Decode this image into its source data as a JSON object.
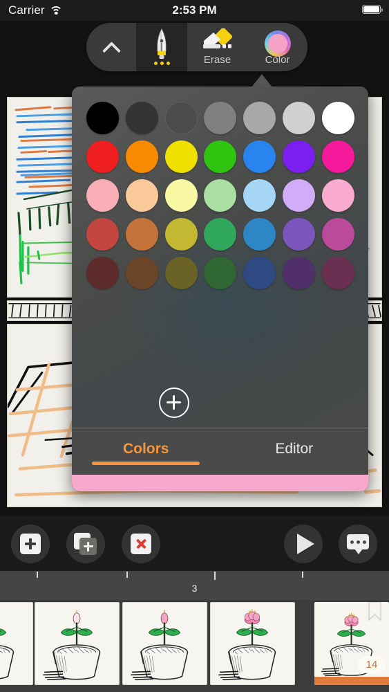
{
  "status_bar": {
    "carrier": "Carrier",
    "wifi_icon": "wifi-icon",
    "time": "2:53 PM",
    "battery_icon": "battery-full-icon"
  },
  "toolbar": {
    "collapse_icon": "chevron-up-icon",
    "pen": {
      "name": "pen-tool",
      "icon": "fountain-pen-nib-icon",
      "more_dots": "three-dots-indicator"
    },
    "erase": {
      "label": "Erase",
      "icon": "eraser-icon"
    },
    "color": {
      "label": "Color",
      "icon": "color-wheel-icon",
      "current_color": "#f4a3c6"
    }
  },
  "color_popover": {
    "add_color_label": "add-color",
    "tabs": [
      {
        "label": "Colors",
        "active": true
      },
      {
        "label": "Editor",
        "active": false
      }
    ],
    "accent_color": "#f5963f",
    "selected_color_bar": "#f7a8cd",
    "swatches": [
      "#000000",
      "#333333",
      "#4b4b4b",
      "#808080",
      "#a8a8a8",
      "#d0d0d0",
      "#ffffff",
      "#f01f1f",
      "#f78a00",
      "#f0e000",
      "#2ec40f",
      "#2a84f0",
      "#7a1ff0",
      "#f51a9b",
      "#f9aeb5",
      "#f9c999",
      "#f9f9a3",
      "#a9dfa0",
      "#a6d6f5",
      "#d2acf7",
      "#f9abd0",
      "#c4443f",
      "#c4743a",
      "#c4b833",
      "#2fa85c",
      "#2f86c4",
      "#7a56bc",
      "#bc4a9c",
      "#5e2b2b",
      "#6b4527",
      "#6b6325",
      "#2f6632",
      "#2f4a82",
      "#512f6b",
      "#6b2f52"
    ]
  },
  "bottom_toolbar": {
    "buttons": [
      {
        "name": "add-frame-button",
        "icon": "plus-square-icon"
      },
      {
        "name": "duplicate-frame-button",
        "icon": "duplicate-plus-icon"
      },
      {
        "name": "delete-frame-button",
        "icon": "x-square-icon"
      },
      {
        "name": "play-button",
        "icon": "play-icon"
      },
      {
        "name": "comment-button",
        "icon": "speech-bubble-dots-icon"
      }
    ]
  },
  "timeline": {
    "marker_label": "3",
    "ticks": [
      53,
      183,
      310,
      437
    ]
  },
  "filmstrip": {
    "frames": [
      {
        "index": 0,
        "partial": true,
        "current": false
      },
      {
        "index": 1,
        "partial": false,
        "current": false
      },
      {
        "index": 2,
        "partial": false,
        "current": false
      },
      {
        "index": 3,
        "partial": false,
        "current": false
      },
      {
        "index": 4,
        "partial": false,
        "current": true,
        "badge": "14",
        "bookmarked": true
      }
    ]
  }
}
